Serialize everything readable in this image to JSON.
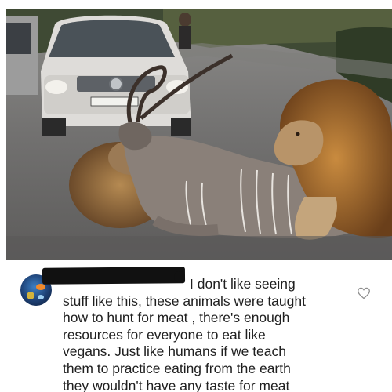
{
  "photo": {
    "license_plate": "ZCP 384-GP",
    "description_icon": "photo"
  },
  "comment": {
    "lines": [
      "I don't like seeing",
      "stuff like this, these animals were taught",
      "how to hunt for meat , there's enough",
      "resources for everyone to eat like",
      "vegans. Just like humans if we teach",
      "them to practice eating from the earth",
      "they wouldn't have any taste for meat"
    ],
    "like_icon": "heart-outline"
  },
  "colors": {
    "redaction": "#111111",
    "text": "#1f1f1f",
    "heart": "#8e8e8e"
  }
}
